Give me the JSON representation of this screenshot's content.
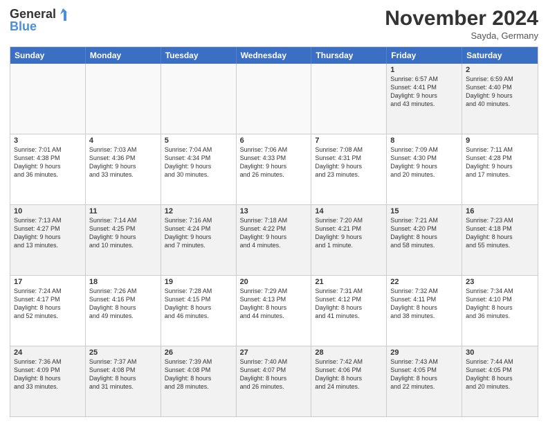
{
  "header": {
    "logo_line1": "General",
    "logo_line2": "Blue",
    "month": "November 2024",
    "location": "Sayda, Germany"
  },
  "days": [
    "Sunday",
    "Monday",
    "Tuesday",
    "Wednesday",
    "Thursday",
    "Friday",
    "Saturday"
  ],
  "rows": [
    [
      {
        "day": "",
        "info": ""
      },
      {
        "day": "",
        "info": ""
      },
      {
        "day": "",
        "info": ""
      },
      {
        "day": "",
        "info": ""
      },
      {
        "day": "",
        "info": ""
      },
      {
        "day": "1",
        "info": "Sunrise: 6:57 AM\nSunset: 4:41 PM\nDaylight: 9 hours\nand 43 minutes."
      },
      {
        "day": "2",
        "info": "Sunrise: 6:59 AM\nSunset: 4:40 PM\nDaylight: 9 hours\nand 40 minutes."
      }
    ],
    [
      {
        "day": "3",
        "info": "Sunrise: 7:01 AM\nSunset: 4:38 PM\nDaylight: 9 hours\nand 36 minutes."
      },
      {
        "day": "4",
        "info": "Sunrise: 7:03 AM\nSunset: 4:36 PM\nDaylight: 9 hours\nand 33 minutes."
      },
      {
        "day": "5",
        "info": "Sunrise: 7:04 AM\nSunset: 4:34 PM\nDaylight: 9 hours\nand 30 minutes."
      },
      {
        "day": "6",
        "info": "Sunrise: 7:06 AM\nSunset: 4:33 PM\nDaylight: 9 hours\nand 26 minutes."
      },
      {
        "day": "7",
        "info": "Sunrise: 7:08 AM\nSunset: 4:31 PM\nDaylight: 9 hours\nand 23 minutes."
      },
      {
        "day": "8",
        "info": "Sunrise: 7:09 AM\nSunset: 4:30 PM\nDaylight: 9 hours\nand 20 minutes."
      },
      {
        "day": "9",
        "info": "Sunrise: 7:11 AM\nSunset: 4:28 PM\nDaylight: 9 hours\nand 17 minutes."
      }
    ],
    [
      {
        "day": "10",
        "info": "Sunrise: 7:13 AM\nSunset: 4:27 PM\nDaylight: 9 hours\nand 13 minutes."
      },
      {
        "day": "11",
        "info": "Sunrise: 7:14 AM\nSunset: 4:25 PM\nDaylight: 9 hours\nand 10 minutes."
      },
      {
        "day": "12",
        "info": "Sunrise: 7:16 AM\nSunset: 4:24 PM\nDaylight: 9 hours\nand 7 minutes."
      },
      {
        "day": "13",
        "info": "Sunrise: 7:18 AM\nSunset: 4:22 PM\nDaylight: 9 hours\nand 4 minutes."
      },
      {
        "day": "14",
        "info": "Sunrise: 7:20 AM\nSunset: 4:21 PM\nDaylight: 9 hours\nand 1 minute."
      },
      {
        "day": "15",
        "info": "Sunrise: 7:21 AM\nSunset: 4:20 PM\nDaylight: 8 hours\nand 58 minutes."
      },
      {
        "day": "16",
        "info": "Sunrise: 7:23 AM\nSunset: 4:18 PM\nDaylight: 8 hours\nand 55 minutes."
      }
    ],
    [
      {
        "day": "17",
        "info": "Sunrise: 7:24 AM\nSunset: 4:17 PM\nDaylight: 8 hours\nand 52 minutes."
      },
      {
        "day": "18",
        "info": "Sunrise: 7:26 AM\nSunset: 4:16 PM\nDaylight: 8 hours\nand 49 minutes."
      },
      {
        "day": "19",
        "info": "Sunrise: 7:28 AM\nSunset: 4:15 PM\nDaylight: 8 hours\nand 46 minutes."
      },
      {
        "day": "20",
        "info": "Sunrise: 7:29 AM\nSunset: 4:13 PM\nDaylight: 8 hours\nand 44 minutes."
      },
      {
        "day": "21",
        "info": "Sunrise: 7:31 AM\nSunset: 4:12 PM\nDaylight: 8 hours\nand 41 minutes."
      },
      {
        "day": "22",
        "info": "Sunrise: 7:32 AM\nSunset: 4:11 PM\nDaylight: 8 hours\nand 38 minutes."
      },
      {
        "day": "23",
        "info": "Sunrise: 7:34 AM\nSunset: 4:10 PM\nDaylight: 8 hours\nand 36 minutes."
      }
    ],
    [
      {
        "day": "24",
        "info": "Sunrise: 7:36 AM\nSunset: 4:09 PM\nDaylight: 8 hours\nand 33 minutes."
      },
      {
        "day": "25",
        "info": "Sunrise: 7:37 AM\nSunset: 4:08 PM\nDaylight: 8 hours\nand 31 minutes."
      },
      {
        "day": "26",
        "info": "Sunrise: 7:39 AM\nSunset: 4:08 PM\nDaylight: 8 hours\nand 28 minutes."
      },
      {
        "day": "27",
        "info": "Sunrise: 7:40 AM\nSunset: 4:07 PM\nDaylight: 8 hours\nand 26 minutes."
      },
      {
        "day": "28",
        "info": "Sunrise: 7:42 AM\nSunset: 4:06 PM\nDaylight: 8 hours\nand 24 minutes."
      },
      {
        "day": "29",
        "info": "Sunrise: 7:43 AM\nSunset: 4:05 PM\nDaylight: 8 hours\nand 22 minutes."
      },
      {
        "day": "30",
        "info": "Sunrise: 7:44 AM\nSunset: 4:05 PM\nDaylight: 8 hours\nand 20 minutes."
      }
    ]
  ]
}
